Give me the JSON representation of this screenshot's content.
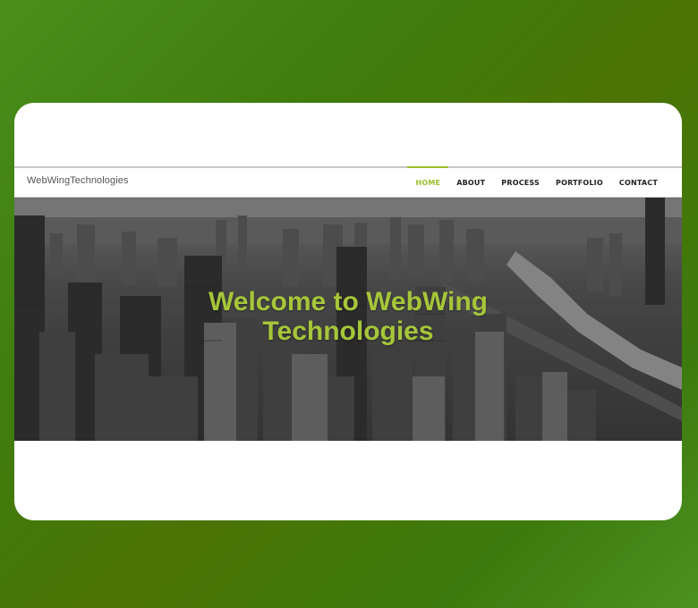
{
  "site": {
    "brand": "WebWingTechnologies"
  },
  "nav": {
    "items": [
      {
        "label": "HOME",
        "active": true
      },
      {
        "label": "ABOUT",
        "active": false
      },
      {
        "label": "PROCESS",
        "active": false
      },
      {
        "label": "PORTFOLIO",
        "active": false
      },
      {
        "label": "CONTACT",
        "active": false
      }
    ]
  },
  "hero": {
    "title_line1": "Welcome to WebWing",
    "title_line2": "Technologies",
    "background_image": "grayscale-city-skyline"
  },
  "colors": {
    "accent": "#9bbf2b",
    "hero_text": "#a6c63a",
    "page_background": "#4b7d10"
  }
}
